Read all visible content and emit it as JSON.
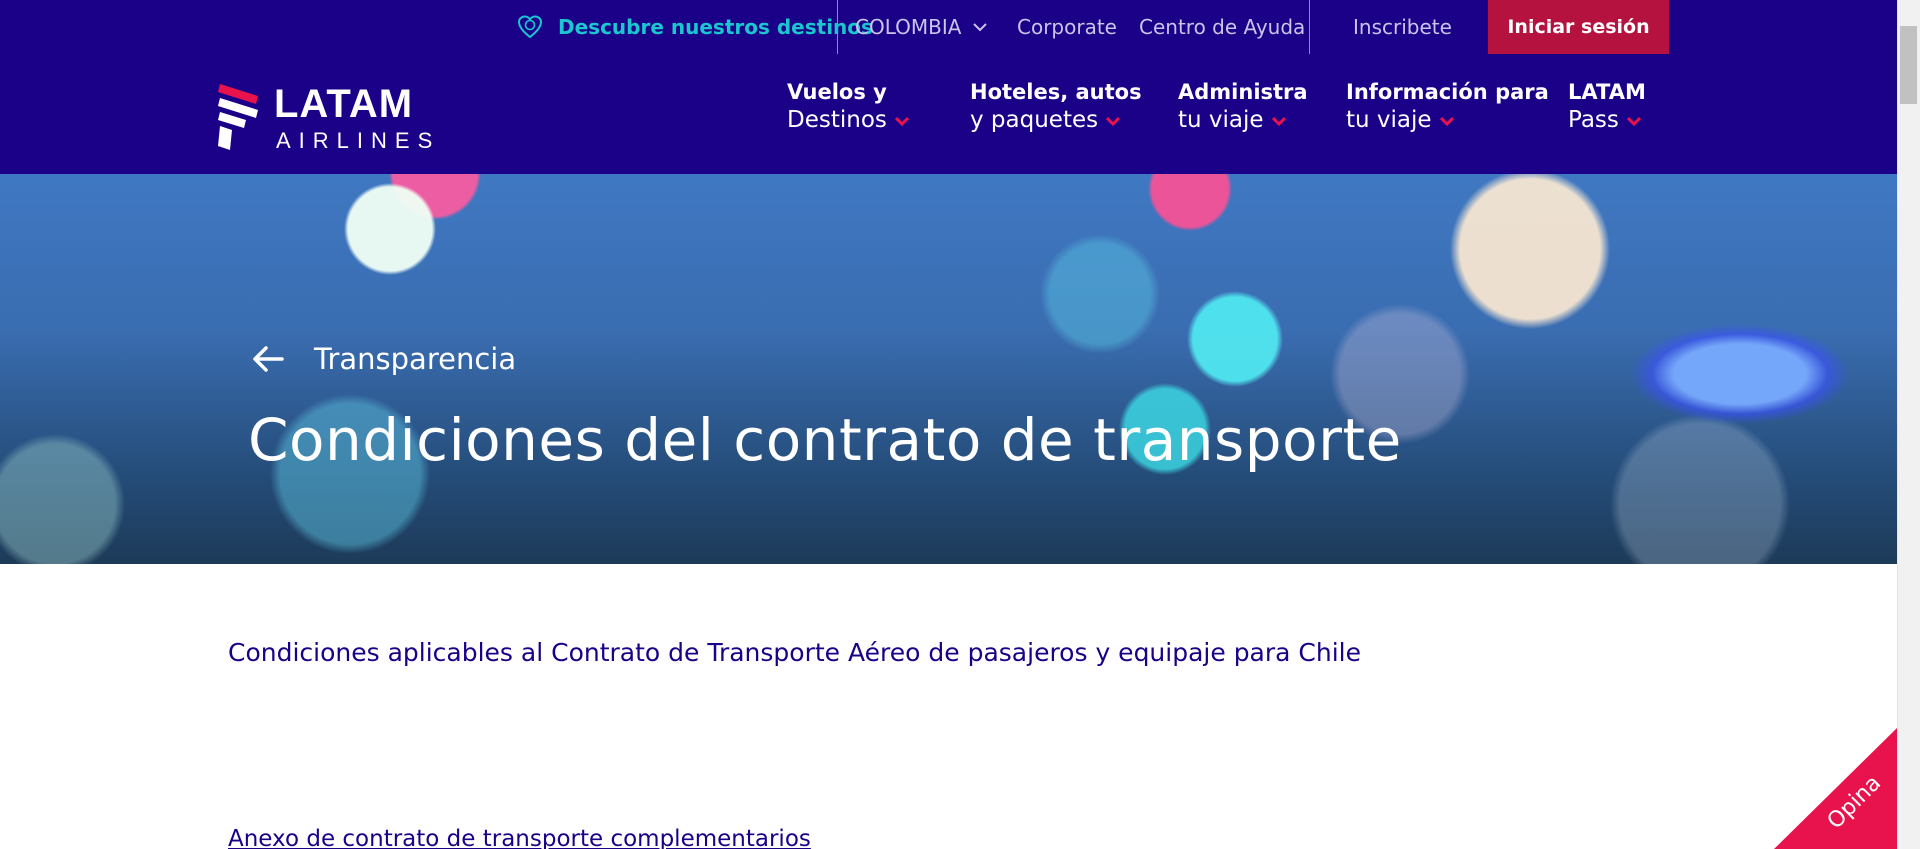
{
  "topbar": {
    "discover_label": "Descubre nuestros destinos",
    "discover_icon": "heart-globe-icon",
    "country_label": "COLOMBIA",
    "corporate_label": "Corporate",
    "help_label": "Centro de Ayuda",
    "signup_label": "Inscribete",
    "login_label": "Iniciar sesión"
  },
  "logo": {
    "word1": "LATAM",
    "word2": "AIRLINES"
  },
  "nav": {
    "items": [
      {
        "line1": "Vuelos y",
        "line2": "Destinos"
      },
      {
        "line1": "Hoteles, autos",
        "line2": "y paquetes"
      },
      {
        "line1": "Administra",
        "line2": "tu viaje"
      },
      {
        "line1": "Información para",
        "line2": "tu viaje"
      },
      {
        "line1": "LATAM",
        "line2": "Pass"
      }
    ]
  },
  "hero": {
    "back_label": "Transparencia",
    "title": "Condiciones del contrato de transporte"
  },
  "content": {
    "subtitle": "Condiciones aplicables al Contrato de Transporte Aéreo de pasajeros y equipaje para Chile",
    "annex_link": "Anexo de contrato de transporte complementarios"
  },
  "feedback": {
    "label": "Opina"
  },
  "colors": {
    "brand_indigo": "#1b0088",
    "accent_crimson": "#b5123f",
    "accent_pink": "#e8124c",
    "accent_teal": "#1bc6cf"
  }
}
